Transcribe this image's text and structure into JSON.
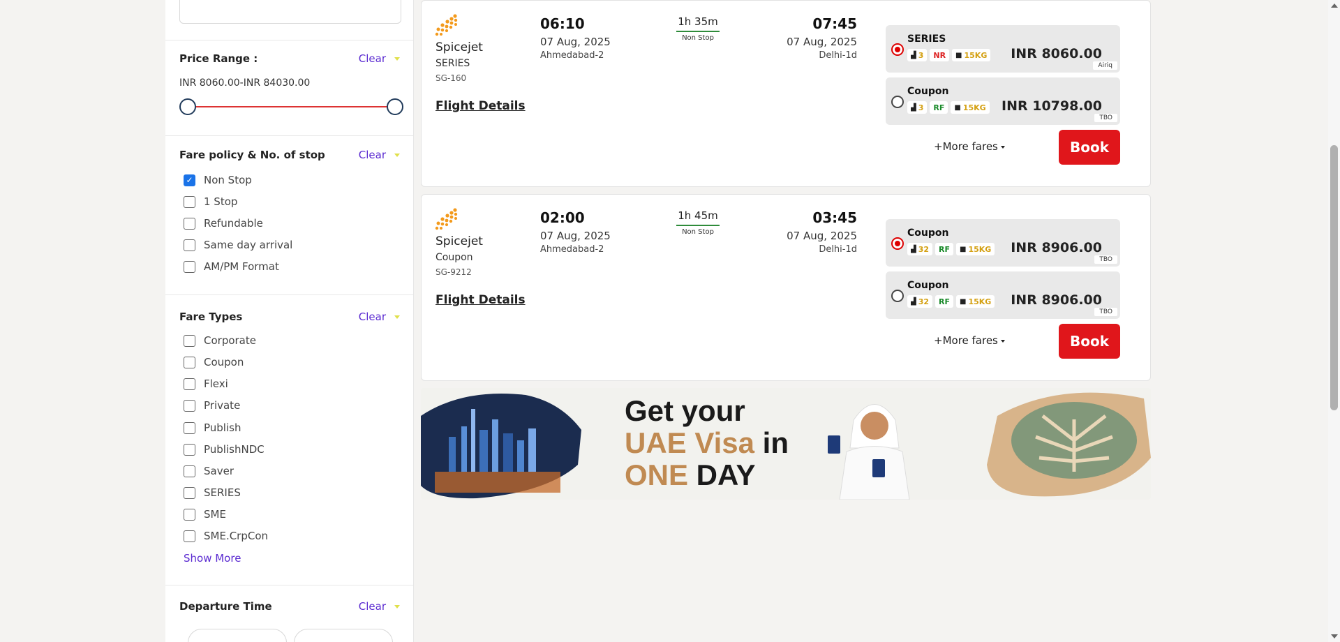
{
  "filters": {
    "price_range": {
      "title": "Price Range :",
      "clear_label": "Clear",
      "range_text": "INR 8060.00-INR 84030.00"
    },
    "fare_policy": {
      "title": "Fare policy & No. of stop",
      "clear_label": "Clear",
      "options": [
        {
          "label": "Non Stop",
          "checked": true
        },
        {
          "label": "1 Stop",
          "checked": false
        },
        {
          "label": "Refundable",
          "checked": false
        },
        {
          "label": "Same day arrival",
          "checked": false
        },
        {
          "label": "AM/PM Format",
          "checked": false
        }
      ]
    },
    "fare_types": {
      "title": "Fare Types",
      "clear_label": "Clear",
      "options": [
        {
          "label": "Corporate",
          "checked": false
        },
        {
          "label": "Coupon",
          "checked": false
        },
        {
          "label": "Flexi",
          "checked": false
        },
        {
          "label": "Private",
          "checked": false
        },
        {
          "label": "Publish",
          "checked": false
        },
        {
          "label": "PublishNDC",
          "checked": false
        },
        {
          "label": "Saver",
          "checked": false
        },
        {
          "label": "SERIES",
          "checked": false
        },
        {
          "label": "SME",
          "checked": false
        },
        {
          "label": "SME.CrpCon",
          "checked": false
        }
      ],
      "show_more_label": "Show More"
    },
    "departure_time": {
      "title": "Departure Time",
      "clear_label": "Clear"
    }
  },
  "flights": [
    {
      "airline": "Spicejet",
      "fare_type": "SERIES",
      "flight_no": "SG-160",
      "details_label": "Flight Details",
      "dep_time": "06:10",
      "dep_date": "07 Aug, 2025",
      "dep_city": "Ahmedabad-2",
      "duration": "1h 35m",
      "stops": "Non Stop",
      "arr_time": "07:45",
      "arr_date": "07 Aug, 2025",
      "arr_city": "Delhi-1d",
      "fares": [
        {
          "name": "SERIES",
          "seats": "3",
          "refund": "NR",
          "refund_color": "red",
          "baggage": "15KG",
          "price": "INR 8060.00",
          "source": "Airiq",
          "selected": true
        },
        {
          "name": "Coupon",
          "seats": "3",
          "refund": "RF",
          "refund_color": "green",
          "baggage": "15KG",
          "price": "INR 10798.00",
          "source": "TBO",
          "selected": false
        }
      ],
      "more_fares_label": "+More fares",
      "book_label": "Book"
    },
    {
      "airline": "Spicejet",
      "fare_type": "Coupon",
      "flight_no": "SG-9212",
      "details_label": "Flight Details",
      "dep_time": "02:00",
      "dep_date": "07 Aug, 2025",
      "dep_city": "Ahmedabad-2",
      "duration": "1h 45m",
      "stops": "Non Stop",
      "arr_time": "03:45",
      "arr_date": "07 Aug, 2025",
      "arr_city": "Delhi-1d",
      "fares": [
        {
          "name": "Coupon",
          "seats": "32",
          "refund": "RF",
          "refund_color": "green",
          "baggage": "15KG",
          "price": "INR 8906.00",
          "source": "TBO",
          "selected": true
        },
        {
          "name": "Coupon",
          "seats": "32",
          "refund": "RF",
          "refund_color": "green",
          "baggage": "15KG",
          "price": "INR 8906.00",
          "source": "TBO",
          "selected": false
        }
      ],
      "more_fares_label": "+More fares",
      "book_label": "Book"
    }
  ],
  "banner": {
    "line1": "Get your",
    "line2_highlight": "UAE Visa",
    "line2_rest": " in",
    "line3_highlight": "ONE",
    "line3_rest": " DAY"
  },
  "colors": {
    "accent_red": "#e0161b",
    "link_purple": "#5b2bd1",
    "duration_green": "#2e8b3a",
    "banner_gold": "#c08a52"
  }
}
